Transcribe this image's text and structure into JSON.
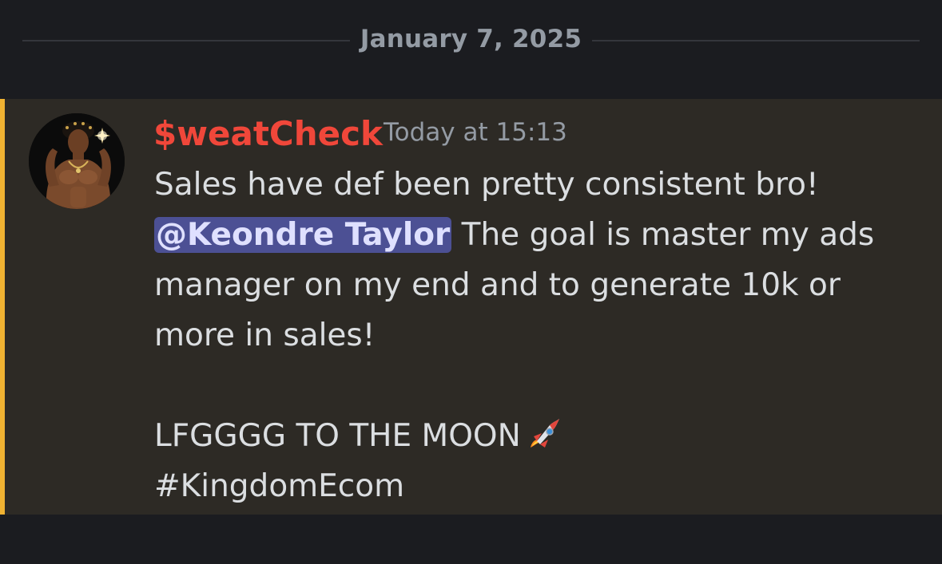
{
  "date_divider": {
    "label": "January 7, 2025"
  },
  "message": {
    "author": {
      "name": "$weatCheck",
      "color": "#f0473a"
    },
    "timestamp": "Today at 15:13",
    "lines": {
      "l1": "Sales have def been pretty consistent bro!",
      "mention": "@Keondre Taylor",
      "l2_rest": " The goal is master my ads",
      "l3": "manager on my end and to generate 10k or",
      "l4": "more in sales!",
      "l5": "LFGGGG TO THE MOON",
      "l6": "#KingdomEcom"
    },
    "emoji": "rocket-icon",
    "highlight_color": "#f0b232"
  }
}
